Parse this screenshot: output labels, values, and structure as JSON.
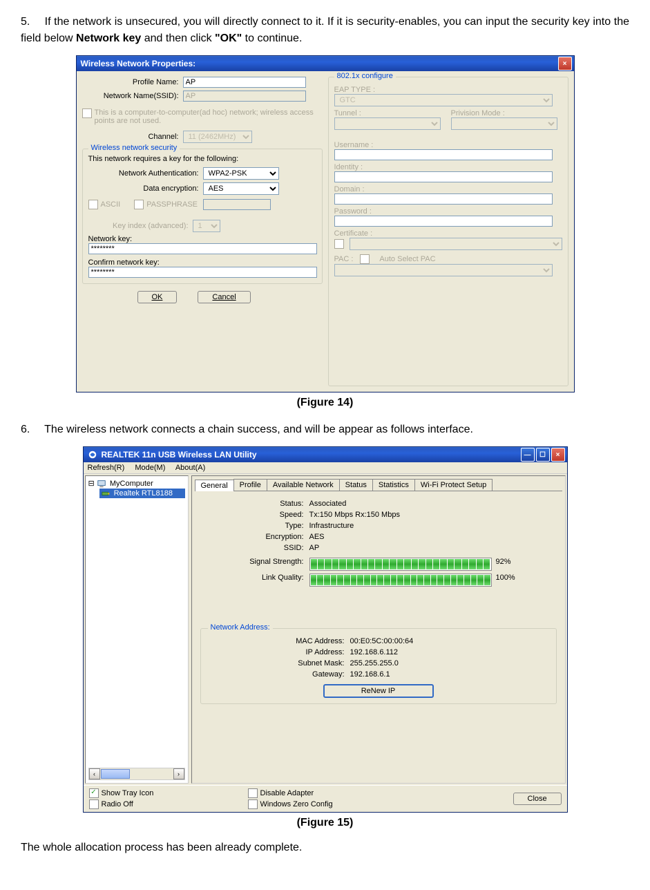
{
  "step5": {
    "number": "5.",
    "text_before_bold1": "If the network is unsecured, you will directly connect to it. If it is security-enables, you can input the security key into the field below ",
    "bold1": "Network key",
    "mid": " and then click ",
    "bold2": "\"OK\"",
    "after": " to continue."
  },
  "fig14": {
    "title": "Wireless Network Properties:",
    "profile_name_label": "Profile Name:",
    "profile_name_value": "AP",
    "ssid_label": "Network Name(SSID):",
    "ssid_value": "AP",
    "adhoc_text": "This is a computer-to-computer(ad hoc) network; wireless access points are not used.",
    "channel_label": "Channel:",
    "channel_value": "11 (2462MHz)",
    "security_legend": "Wireless network security",
    "requires_key": "This network requires a key for the following:",
    "net_auth_label": "Network Authentication:",
    "net_auth_value": "WPA2-PSK",
    "data_enc_label": "Data encryption:",
    "data_enc_value": "AES",
    "ascii": "ASCII",
    "passphrase": "PASSPHRASE",
    "key_index_label": "Key index (advanced):",
    "key_index_value": "1",
    "network_key_label": "Network key:",
    "network_key_value": "********",
    "confirm_key_label": "Confirm network key:",
    "confirm_key_value": "********",
    "ok": "OK",
    "cancel": "Cancel",
    "right_legend": "802.1x configure",
    "eap_type": "EAP TYPE :",
    "eap_value": "GTC",
    "tunnel": "Tunnel :",
    "privision": "Privision Mode :",
    "username": "Username :",
    "identity": "Identity :",
    "domain": "Domain :",
    "password": "Password :",
    "certificate": "Certificate :",
    "pac": "PAC :",
    "auto_pac": "Auto Select PAC",
    "caption": "(Figure 14)"
  },
  "step6": {
    "number": "6.",
    "text": "The wireless network connects a chain success, and will be appear as follows interface."
  },
  "fig15": {
    "title": "REALTEK 11n USB Wireless LAN Utility",
    "menu": {
      "refresh": "Refresh(R)",
      "mode": "Mode(M)",
      "about": "About(A)"
    },
    "tree": {
      "root": "MyComputer",
      "child": "Realtek RTL8188"
    },
    "tabs": {
      "general": "General",
      "profile": "Profile",
      "available": "Available Network",
      "status": "Status",
      "statistics": "Statistics",
      "wps": "Wi-Fi Protect Setup"
    },
    "status": {
      "status_l": "Status:",
      "status_v": "Associated",
      "speed_l": "Speed:",
      "speed_v": "Tx:150 Mbps Rx:150 Mbps",
      "type_l": "Type:",
      "type_v": "Infrastructure",
      "enc_l": "Encryption:",
      "enc_v": "AES",
      "ssid_l": "SSID:",
      "ssid_v": "AP",
      "signal_l": "Signal Strength:",
      "signal_pct": "92%",
      "link_l": "Link Quality:",
      "link_pct": "100%"
    },
    "netaddr": {
      "legend": "Network Address:",
      "mac_l": "MAC Address:",
      "mac_v": "00:E0:5C:00:00:64",
      "ip_l": "IP Address:",
      "ip_v": "192.168.6.112",
      "mask_l": "Subnet Mask:",
      "mask_v": "255.255.255.0",
      "gw_l": "Gateway:",
      "gw_v": "192.168.6.1",
      "renew": "ReNew IP"
    },
    "bottom": {
      "show_tray": "Show Tray Icon",
      "radio_off": "Radio Off",
      "disable_adapter": "Disable Adapter",
      "wzc": "Windows Zero Config",
      "close": "Close"
    },
    "caption": "(Figure 15)"
  },
  "bottom_text": "The whole allocation process has been already complete."
}
